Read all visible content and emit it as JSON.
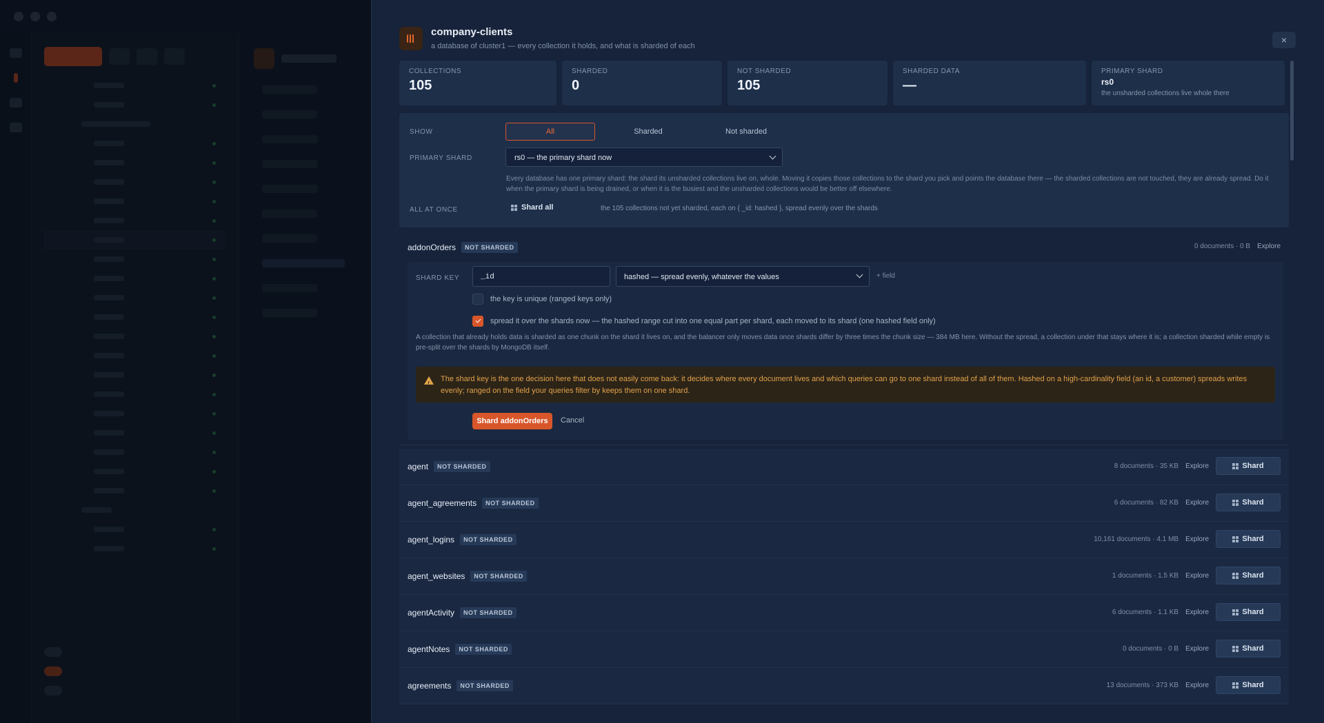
{
  "drawer": {
    "title": "company-clients",
    "subtitle": "a database of cluster1 — every collection it holds, and what is sharded of each",
    "close": "×"
  },
  "stats": [
    {
      "label": "COLLECTIONS",
      "value": "105"
    },
    {
      "label": "SHARDED",
      "value": "0"
    },
    {
      "label": "NOT SHARDED",
      "value": "105"
    },
    {
      "label": "SHARDED DATA",
      "value": "—"
    },
    {
      "label": "PRIMARY SHARD",
      "value": "rs0",
      "note": "the unsharded collections live whole there"
    }
  ],
  "controls": {
    "show_label": "SHOW",
    "show_options": [
      "All",
      "Sharded",
      "Not sharded"
    ],
    "show_selected": "All",
    "primary_label": "PRIMARY SHARD",
    "primary_value": "rs0 — the primary shard now",
    "primary_desc": "Every database has one primary shard: the shard its unsharded collections live on, whole. Moving it copies those collections to the shard you pick and points the database there — the sharded collections are not touched, they are already spread. Do it when the primary shard is being drained, or when it is the busiest and the unsharded collections would be better off elsewhere.",
    "all_label": "ALL AT ONCE",
    "shard_all": "Shard all",
    "shard_all_note": "the 105 collections not yet sharded, each on { _id: hashed }, spread evenly over the shards"
  },
  "expanded": {
    "name": "addonOrders",
    "badge": "NOT SHARDED",
    "meta": "0 documents · 0 B",
    "explore": "Explore",
    "shard_key_label": "SHARD KEY",
    "key_value": "_id",
    "key_type": "hashed — spread evenly, whatever the values",
    "add_field": "+ field",
    "unique_label": "the key is unique (ranged keys only)",
    "unique_checked": false,
    "spread_label": "spread it over the shards now — the hashed range cut into one equal part per shard, each moved to its shard (one hashed field only)",
    "spread_checked": true,
    "explain": "A collection that already holds data is sharded as one chunk on the shard it lives on, and the balancer only moves data once shards differ by three times the chunk size — 384 MB here. Without the spread, a collection under that stays where it is; a collection sharded while empty is pre-split over the shards by MongoDB itself.",
    "warning": "The shard key is the one decision here that does not easily come back: it decides where every document lives and which queries can go to one shard instead of all of them. Hashed on a high-cardinality field (an id, a customer) spreads writes evenly; ranged on the field your queries filter by keeps them on one shard.",
    "submit": "Shard addonOrders",
    "cancel": "Cancel"
  },
  "collections": [
    {
      "name": "agent",
      "badge": "NOT SHARDED",
      "meta": "8 documents · 35 KB",
      "explore": "Explore",
      "action": "Shard"
    },
    {
      "name": "agent_agreements",
      "badge": "NOT SHARDED",
      "meta": "6 documents · 82 KB",
      "explore": "Explore",
      "action": "Shard"
    },
    {
      "name": "agent_logins",
      "badge": "NOT SHARDED",
      "meta": "10,161 documents · 4.1 MB",
      "explore": "Explore",
      "action": "Shard"
    },
    {
      "name": "agent_websites",
      "badge": "NOT SHARDED",
      "meta": "1 documents · 1.5 KB",
      "explore": "Explore",
      "action": "Shard"
    },
    {
      "name": "agentActivity",
      "badge": "NOT SHARDED",
      "meta": "6 documents · 1.1 KB",
      "explore": "Explore",
      "action": "Shard"
    },
    {
      "name": "agentNotes",
      "badge": "NOT SHARDED",
      "meta": "0 documents · 0 B",
      "explore": "Explore",
      "action": "Shard"
    },
    {
      "name": "agreements",
      "badge": "NOT SHARDED",
      "meta": "13 documents · 373 KB",
      "explore": "Explore",
      "action": "Shard"
    }
  ],
  "colors": {
    "accent": "#d8562a",
    "warning": "#e0a24a",
    "panel": "#16233a"
  }
}
